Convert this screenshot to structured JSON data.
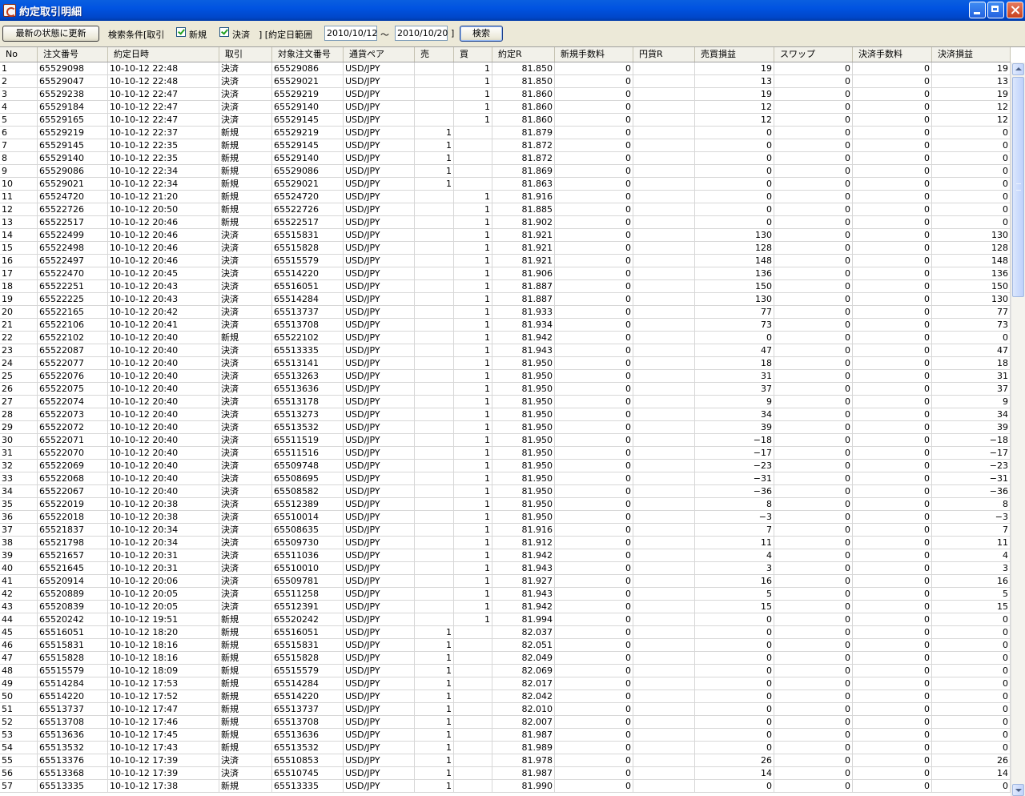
{
  "window": {
    "title": "約定取引明細"
  },
  "toolbar": {
    "refresh_label": "最新の状態に更新",
    "criteria_label": "検索条件[取引",
    "new_label": "新規",
    "settle_label": "決済",
    "range_bracket": "] [約定日範囲",
    "date_from": "2010/10/12",
    "tilde": "～",
    "date_to": "2010/10/20",
    "close_bracket": "]",
    "search_label": "検索"
  },
  "table": {
    "headers": [
      "No",
      "注文番号",
      "約定日時",
      "取引",
      "対象注文番号",
      "通貨ペア",
      "売",
      "買",
      "約定R",
      "新規手数料",
      "円貨R",
      "売買損益",
      "スワップ",
      "決済手数料",
      "決済損益"
    ],
    "rows": [
      [
        "1",
        "65529098",
        "10-10-12 22:48",
        "決済",
        "65529086",
        "USD/JPY",
        "",
        "1",
        "81.850",
        "0",
        "",
        "19",
        "0",
        "0",
        "19"
      ],
      [
        "2",
        "65529047",
        "10-10-12 22:48",
        "決済",
        "65529021",
        "USD/JPY",
        "",
        "1",
        "81.850",
        "0",
        "",
        "13",
        "0",
        "0",
        "13"
      ],
      [
        "3",
        "65529238",
        "10-10-12 22:47",
        "決済",
        "65529219",
        "USD/JPY",
        "",
        "1",
        "81.860",
        "0",
        "",
        "19",
        "0",
        "0",
        "19"
      ],
      [
        "4",
        "65529184",
        "10-10-12 22:47",
        "決済",
        "65529140",
        "USD/JPY",
        "",
        "1",
        "81.860",
        "0",
        "",
        "12",
        "0",
        "0",
        "12"
      ],
      [
        "5",
        "65529165",
        "10-10-12 22:47",
        "決済",
        "65529145",
        "USD/JPY",
        "",
        "1",
        "81.860",
        "0",
        "",
        "12",
        "0",
        "0",
        "12"
      ],
      [
        "6",
        "65529219",
        "10-10-12 22:37",
        "新規",
        "65529219",
        "USD/JPY",
        "1",
        "",
        "81.879",
        "0",
        "",
        "0",
        "0",
        "0",
        "0"
      ],
      [
        "7",
        "65529145",
        "10-10-12 22:35",
        "新規",
        "65529145",
        "USD/JPY",
        "1",
        "",
        "81.872",
        "0",
        "",
        "0",
        "0",
        "0",
        "0"
      ],
      [
        "8",
        "65529140",
        "10-10-12 22:35",
        "新規",
        "65529140",
        "USD/JPY",
        "1",
        "",
        "81.872",
        "0",
        "",
        "0",
        "0",
        "0",
        "0"
      ],
      [
        "9",
        "65529086",
        "10-10-12 22:34",
        "新規",
        "65529086",
        "USD/JPY",
        "1",
        "",
        "81.869",
        "0",
        "",
        "0",
        "0",
        "0",
        "0"
      ],
      [
        "10",
        "65529021",
        "10-10-12 22:34",
        "新規",
        "65529021",
        "USD/JPY",
        "1",
        "",
        "81.863",
        "0",
        "",
        "0",
        "0",
        "0",
        "0"
      ],
      [
        "11",
        "65524720",
        "10-10-12 21:20",
        "新規",
        "65524720",
        "USD/JPY",
        "",
        "1",
        "81.916",
        "0",
        "",
        "0",
        "0",
        "0",
        "0"
      ],
      [
        "12",
        "65522726",
        "10-10-12 20:50",
        "新規",
        "65522726",
        "USD/JPY",
        "",
        "1",
        "81.885",
        "0",
        "",
        "0",
        "0",
        "0",
        "0"
      ],
      [
        "13",
        "65522517",
        "10-10-12 20:46",
        "新規",
        "65522517",
        "USD/JPY",
        "",
        "1",
        "81.902",
        "0",
        "",
        "0",
        "0",
        "0",
        "0"
      ],
      [
        "14",
        "65522499",
        "10-10-12 20:46",
        "決済",
        "65515831",
        "USD/JPY",
        "",
        "1",
        "81.921",
        "0",
        "",
        "130",
        "0",
        "0",
        "130"
      ],
      [
        "15",
        "65522498",
        "10-10-12 20:46",
        "決済",
        "65515828",
        "USD/JPY",
        "",
        "1",
        "81.921",
        "0",
        "",
        "128",
        "0",
        "0",
        "128"
      ],
      [
        "16",
        "65522497",
        "10-10-12 20:46",
        "決済",
        "65515579",
        "USD/JPY",
        "",
        "1",
        "81.921",
        "0",
        "",
        "148",
        "0",
        "0",
        "148"
      ],
      [
        "17",
        "65522470",
        "10-10-12 20:45",
        "決済",
        "65514220",
        "USD/JPY",
        "",
        "1",
        "81.906",
        "0",
        "",
        "136",
        "0",
        "0",
        "136"
      ],
      [
        "18",
        "65522251",
        "10-10-12 20:43",
        "決済",
        "65516051",
        "USD/JPY",
        "",
        "1",
        "81.887",
        "0",
        "",
        "150",
        "0",
        "0",
        "150"
      ],
      [
        "19",
        "65522225",
        "10-10-12 20:43",
        "決済",
        "65514284",
        "USD/JPY",
        "",
        "1",
        "81.887",
        "0",
        "",
        "130",
        "0",
        "0",
        "130"
      ],
      [
        "20",
        "65522165",
        "10-10-12 20:42",
        "決済",
        "65513737",
        "USD/JPY",
        "",
        "1",
        "81.933",
        "0",
        "",
        "77",
        "0",
        "0",
        "77"
      ],
      [
        "21",
        "65522106",
        "10-10-12 20:41",
        "決済",
        "65513708",
        "USD/JPY",
        "",
        "1",
        "81.934",
        "0",
        "",
        "73",
        "0",
        "0",
        "73"
      ],
      [
        "22",
        "65522102",
        "10-10-12 20:40",
        "新規",
        "65522102",
        "USD/JPY",
        "",
        "1",
        "81.942",
        "0",
        "",
        "0",
        "0",
        "0",
        "0"
      ],
      [
        "23",
        "65522087",
        "10-10-12 20:40",
        "決済",
        "65513335",
        "USD/JPY",
        "",
        "1",
        "81.943",
        "0",
        "",
        "47",
        "0",
        "0",
        "47"
      ],
      [
        "24",
        "65522077",
        "10-10-12 20:40",
        "決済",
        "65513141",
        "USD/JPY",
        "",
        "1",
        "81.950",
        "0",
        "",
        "18",
        "0",
        "0",
        "18"
      ],
      [
        "25",
        "65522076",
        "10-10-12 20:40",
        "決済",
        "65513263",
        "USD/JPY",
        "",
        "1",
        "81.950",
        "0",
        "",
        "31",
        "0",
        "0",
        "31"
      ],
      [
        "26",
        "65522075",
        "10-10-12 20:40",
        "決済",
        "65513636",
        "USD/JPY",
        "",
        "1",
        "81.950",
        "0",
        "",
        "37",
        "0",
        "0",
        "37"
      ],
      [
        "27",
        "65522074",
        "10-10-12 20:40",
        "決済",
        "65513178",
        "USD/JPY",
        "",
        "1",
        "81.950",
        "0",
        "",
        "9",
        "0",
        "0",
        "9"
      ],
      [
        "28",
        "65522073",
        "10-10-12 20:40",
        "決済",
        "65513273",
        "USD/JPY",
        "",
        "1",
        "81.950",
        "0",
        "",
        "34",
        "0",
        "0",
        "34"
      ],
      [
        "29",
        "65522072",
        "10-10-12 20:40",
        "決済",
        "65513532",
        "USD/JPY",
        "",
        "1",
        "81.950",
        "0",
        "",
        "39",
        "0",
        "0",
        "39"
      ],
      [
        "30",
        "65522071",
        "10-10-12 20:40",
        "決済",
        "65511519",
        "USD/JPY",
        "",
        "1",
        "81.950",
        "0",
        "",
        "−18",
        "0",
        "0",
        "−18"
      ],
      [
        "31",
        "65522070",
        "10-10-12 20:40",
        "決済",
        "65511516",
        "USD/JPY",
        "",
        "1",
        "81.950",
        "0",
        "",
        "−17",
        "0",
        "0",
        "−17"
      ],
      [
        "32",
        "65522069",
        "10-10-12 20:40",
        "決済",
        "65509748",
        "USD/JPY",
        "",
        "1",
        "81.950",
        "0",
        "",
        "−23",
        "0",
        "0",
        "−23"
      ],
      [
        "33",
        "65522068",
        "10-10-12 20:40",
        "決済",
        "65508695",
        "USD/JPY",
        "",
        "1",
        "81.950",
        "0",
        "",
        "−31",
        "0",
        "0",
        "−31"
      ],
      [
        "34",
        "65522067",
        "10-10-12 20:40",
        "決済",
        "65508582",
        "USD/JPY",
        "",
        "1",
        "81.950",
        "0",
        "",
        "−36",
        "0",
        "0",
        "−36"
      ],
      [
        "35",
        "65522019",
        "10-10-12 20:38",
        "決済",
        "65512389",
        "USD/JPY",
        "",
        "1",
        "81.950",
        "0",
        "",
        "8",
        "0",
        "0",
        "8"
      ],
      [
        "36",
        "65522018",
        "10-10-12 20:38",
        "決済",
        "65510014",
        "USD/JPY",
        "",
        "1",
        "81.950",
        "0",
        "",
        "−3",
        "0",
        "0",
        "−3"
      ],
      [
        "37",
        "65521837",
        "10-10-12 20:34",
        "決済",
        "65508635",
        "USD/JPY",
        "",
        "1",
        "81.916",
        "0",
        "",
        "7",
        "0",
        "0",
        "7"
      ],
      [
        "38",
        "65521798",
        "10-10-12 20:34",
        "決済",
        "65509730",
        "USD/JPY",
        "",
        "1",
        "81.912",
        "0",
        "",
        "11",
        "0",
        "0",
        "11"
      ],
      [
        "39",
        "65521657",
        "10-10-12 20:31",
        "決済",
        "65511036",
        "USD/JPY",
        "",
        "1",
        "81.942",
        "0",
        "",
        "4",
        "0",
        "0",
        "4"
      ],
      [
        "40",
        "65521645",
        "10-10-12 20:31",
        "決済",
        "65510010",
        "USD/JPY",
        "",
        "1",
        "81.943",
        "0",
        "",
        "3",
        "0",
        "0",
        "3"
      ],
      [
        "41",
        "65520914",
        "10-10-12 20:06",
        "決済",
        "65509781",
        "USD/JPY",
        "",
        "1",
        "81.927",
        "0",
        "",
        "16",
        "0",
        "0",
        "16"
      ],
      [
        "42",
        "65520889",
        "10-10-12 20:05",
        "決済",
        "65511258",
        "USD/JPY",
        "",
        "1",
        "81.943",
        "0",
        "",
        "5",
        "0",
        "0",
        "5"
      ],
      [
        "43",
        "65520839",
        "10-10-12 20:05",
        "決済",
        "65512391",
        "USD/JPY",
        "",
        "1",
        "81.942",
        "0",
        "",
        "15",
        "0",
        "0",
        "15"
      ],
      [
        "44",
        "65520242",
        "10-10-12 19:51",
        "新規",
        "65520242",
        "USD/JPY",
        "",
        "1",
        "81.994",
        "0",
        "",
        "0",
        "0",
        "0",
        "0"
      ],
      [
        "45",
        "65516051",
        "10-10-12 18:20",
        "新規",
        "65516051",
        "USD/JPY",
        "1",
        "",
        "82.037",
        "0",
        "",
        "0",
        "0",
        "0",
        "0"
      ],
      [
        "46",
        "65515831",
        "10-10-12 18:16",
        "新規",
        "65515831",
        "USD/JPY",
        "1",
        "",
        "82.051",
        "0",
        "",
        "0",
        "0",
        "0",
        "0"
      ],
      [
        "47",
        "65515828",
        "10-10-12 18:16",
        "新規",
        "65515828",
        "USD/JPY",
        "1",
        "",
        "82.049",
        "0",
        "",
        "0",
        "0",
        "0",
        "0"
      ],
      [
        "48",
        "65515579",
        "10-10-12 18:09",
        "新規",
        "65515579",
        "USD/JPY",
        "1",
        "",
        "82.069",
        "0",
        "",
        "0",
        "0",
        "0",
        "0"
      ],
      [
        "49",
        "65514284",
        "10-10-12 17:53",
        "新規",
        "65514284",
        "USD/JPY",
        "1",
        "",
        "82.017",
        "0",
        "",
        "0",
        "0",
        "0",
        "0"
      ],
      [
        "50",
        "65514220",
        "10-10-12 17:52",
        "新規",
        "65514220",
        "USD/JPY",
        "1",
        "",
        "82.042",
        "0",
        "",
        "0",
        "0",
        "0",
        "0"
      ],
      [
        "51",
        "65513737",
        "10-10-12 17:47",
        "新規",
        "65513737",
        "USD/JPY",
        "1",
        "",
        "82.010",
        "0",
        "",
        "0",
        "0",
        "0",
        "0"
      ],
      [
        "52",
        "65513708",
        "10-10-12 17:46",
        "新規",
        "65513708",
        "USD/JPY",
        "1",
        "",
        "82.007",
        "0",
        "",
        "0",
        "0",
        "0",
        "0"
      ],
      [
        "53",
        "65513636",
        "10-10-12 17:45",
        "新規",
        "65513636",
        "USD/JPY",
        "1",
        "",
        "81.987",
        "0",
        "",
        "0",
        "0",
        "0",
        "0"
      ],
      [
        "54",
        "65513532",
        "10-10-12 17:43",
        "新規",
        "65513532",
        "USD/JPY",
        "1",
        "",
        "81.989",
        "0",
        "",
        "0",
        "0",
        "0",
        "0"
      ],
      [
        "55",
        "65513376",
        "10-10-12 17:39",
        "決済",
        "65510853",
        "USD/JPY",
        "1",
        "",
        "81.978",
        "0",
        "",
        "26",
        "0",
        "0",
        "26"
      ],
      [
        "56",
        "65513368",
        "10-10-12 17:39",
        "決済",
        "65510745",
        "USD/JPY",
        "1",
        "",
        "81.987",
        "0",
        "",
        "14",
        "0",
        "0",
        "14"
      ],
      [
        "57",
        "65513335",
        "10-10-12 17:38",
        "新規",
        "65513335",
        "USD/JPY",
        "1",
        "",
        "81.990",
        "0",
        "",
        "0",
        "0",
        "0",
        "0"
      ]
    ]
  }
}
